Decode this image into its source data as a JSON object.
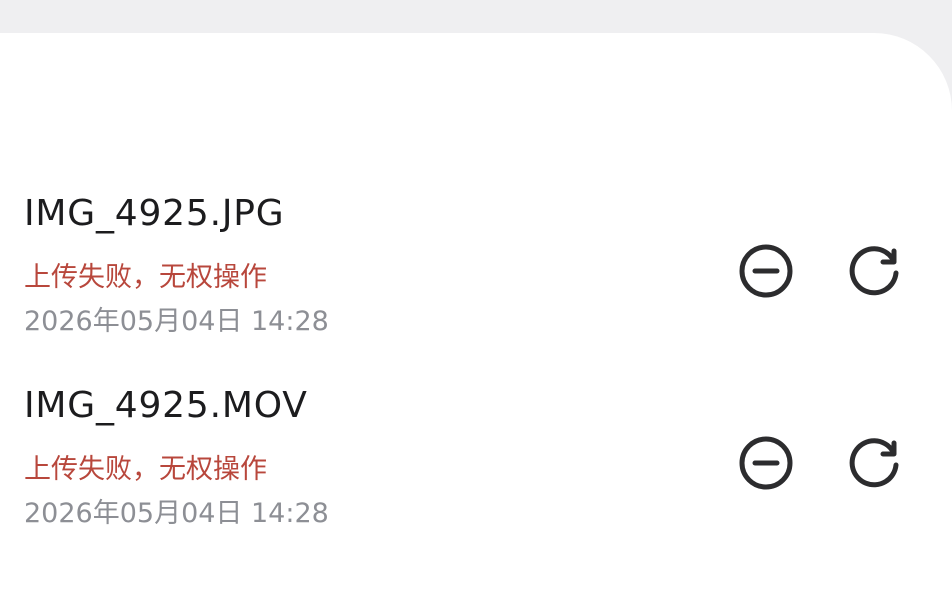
{
  "files": [
    {
      "name": "IMG_4925.JPG",
      "status": "上传失败，无权操作",
      "timestamp": "2026年05月04日 14:28",
      "actions": {
        "remove_icon": "minus-circle-icon",
        "retry_icon": "refresh-icon"
      }
    },
    {
      "name": "IMG_4925.MOV",
      "status": "上传失败，无权操作",
      "timestamp": "2026年05月04日 14:28",
      "actions": {
        "remove_icon": "minus-circle-icon",
        "retry_icon": "refresh-icon"
      }
    }
  ],
  "colors": {
    "background": "#efeff1",
    "sheet": "#ffffff",
    "primary_text": "#1c1c1e",
    "error_text": "#b8473c",
    "secondary_text": "#8d8f95",
    "icon": "#2c2c2e"
  }
}
